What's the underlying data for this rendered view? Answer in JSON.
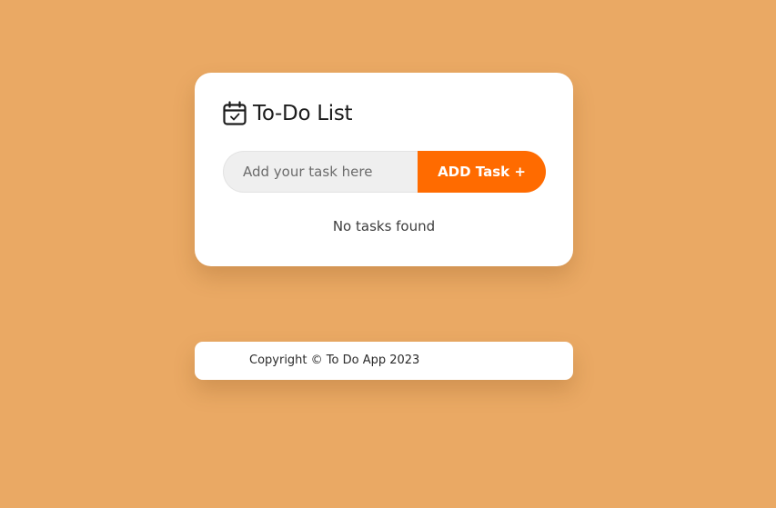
{
  "app": {
    "title": "To-Do List",
    "title_icon": "calendar-check-icon"
  },
  "task_input": {
    "placeholder": "Add your task here",
    "value": ""
  },
  "add_button": {
    "label": "ADD Task +"
  },
  "task_list": {
    "empty_message": "No tasks found",
    "items": []
  },
  "footer": {
    "copyright": "Copyright © To Do App 2023"
  },
  "colors": {
    "background": "#EAA964",
    "accent": "#FF6B00",
    "card": "#FFFFFF",
    "input_bg": "#EFEFEF"
  }
}
